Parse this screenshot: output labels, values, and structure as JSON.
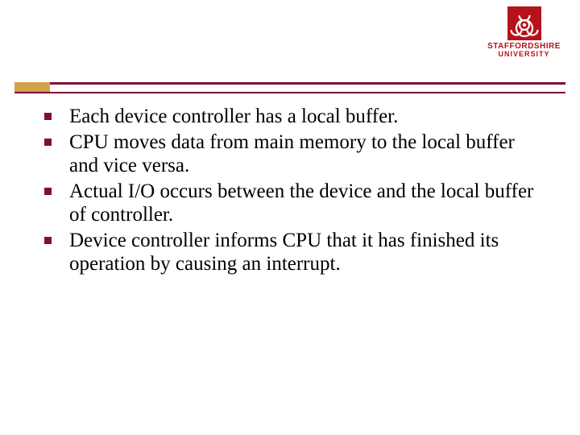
{
  "logo": {
    "name": "STAFFORDSHIRE",
    "subname": "UNIVERSITY"
  },
  "bullets": [
    "Each device controller has a local buffer.",
    "CPU moves data from main memory to the local buffer and vice versa.",
    "Actual I/O occurs between the device and the local buffer of controller.",
    "Device controller informs CPU that it has finished its operation by causing an interrupt."
  ]
}
